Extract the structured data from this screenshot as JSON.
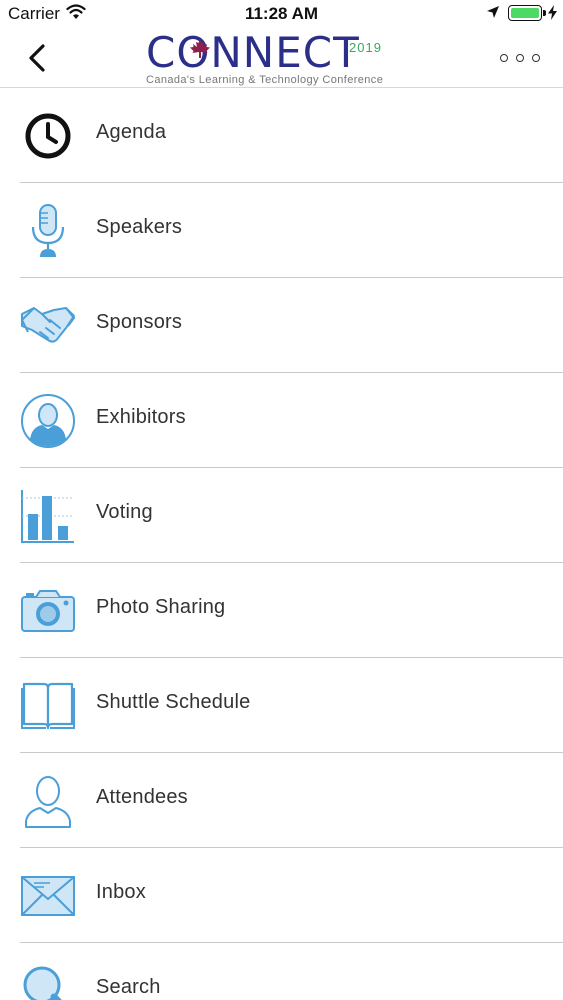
{
  "status_bar": {
    "carrier": "Carrier",
    "time": "11:28 AM",
    "battery_level": 1.0
  },
  "nav": {
    "logo_word": "CONNECT",
    "logo_year": "2019",
    "logo_subtitle": "Canada's Learning & Technology Conference",
    "back_icon": "chevron-left-icon",
    "more_icon": "ellipsis-icon"
  },
  "colors": {
    "icon_blue": "#4a9fd8",
    "icon_fill": "#cfe6f7",
    "logo_navy": "#2c2f8a",
    "logo_green": "#39a85a",
    "maple_red": "#8e1f4f"
  },
  "menu": [
    {
      "label": "Agenda",
      "icon": "clock-icon"
    },
    {
      "label": "Speakers",
      "icon": "microphone-icon"
    },
    {
      "label": "Sponsors",
      "icon": "handshake-icon"
    },
    {
      "label": "Exhibitors",
      "icon": "person-circle-icon"
    },
    {
      "label": "Voting",
      "icon": "bar-chart-icon"
    },
    {
      "label": "Photo Sharing",
      "icon": "camera-icon"
    },
    {
      "label": "Shuttle Schedule",
      "icon": "book-icon"
    },
    {
      "label": "Attendees",
      "icon": "user-outline-icon"
    },
    {
      "label": "Inbox",
      "icon": "envelope-icon"
    },
    {
      "label": "Search",
      "icon": "magnifier-icon"
    }
  ]
}
